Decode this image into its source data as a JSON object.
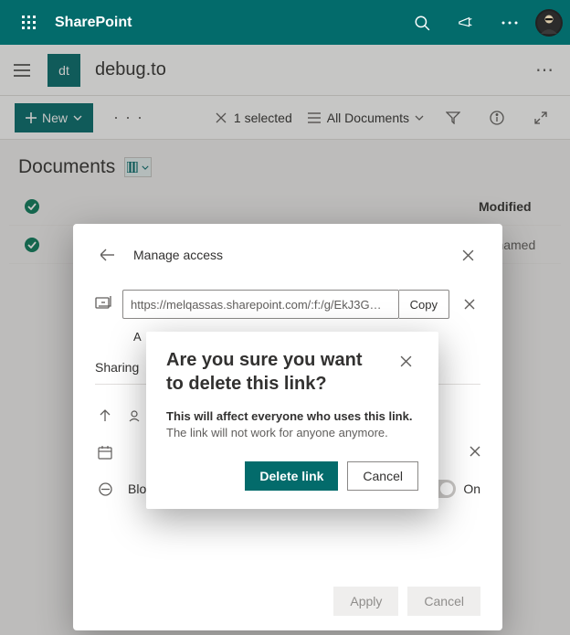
{
  "suite": {
    "brand": "SharePoint"
  },
  "site": {
    "logo_text": "dt",
    "name": "debug.to"
  },
  "cmd": {
    "new_label": "New",
    "selected_label": "1 selected",
    "view_label": "All Documents"
  },
  "page": {
    "title": "Documents"
  },
  "list": {
    "header_modified": "Modified",
    "row1_modified": "Mohamed"
  },
  "panel": {
    "title": "Manage access",
    "link_url": "https://melqassas.sharepoint.com/:f:/g/EkJ3G…",
    "copy_label": "Copy",
    "sub_initial": "A",
    "settings_title": "Sharing",
    "row_expiry": "",
    "row_block": "Block download",
    "block_state": "On",
    "apply_label": "Apply",
    "cancel_label": "Cancel"
  },
  "dialog": {
    "title": "Are you sure you want to delete this link?",
    "body_strong": "This will affect everyone who uses this link.",
    "body_rest": " The link will not work for anyone anymore.",
    "delete_label": "Delete link",
    "cancel_label": "Cancel"
  }
}
